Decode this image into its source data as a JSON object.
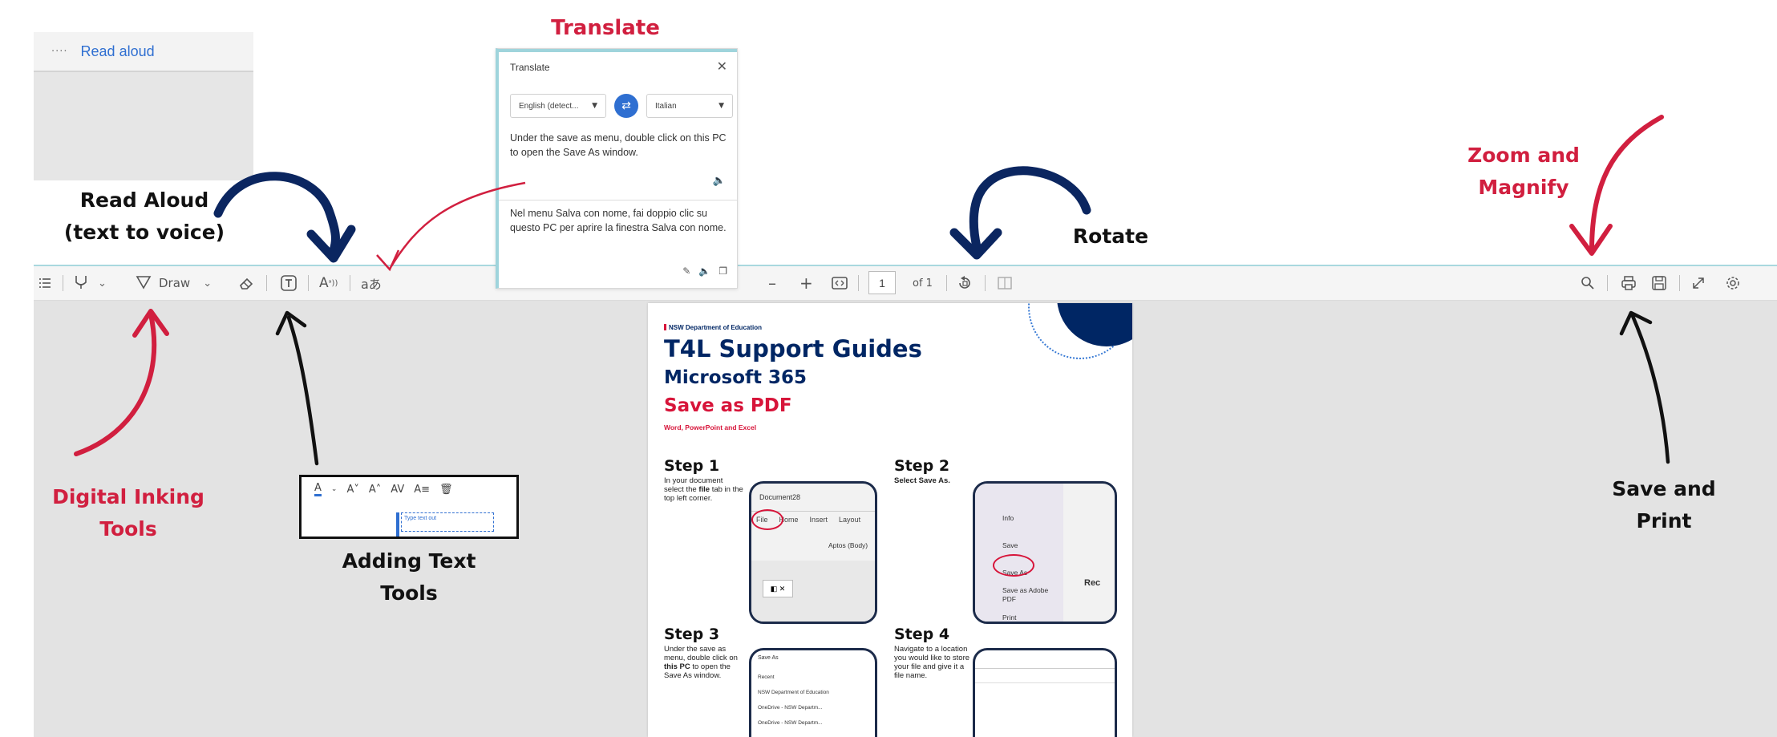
{
  "annotations": {
    "translate": "Translate",
    "read_aloud": [
      "Read Aloud",
      "(text to voice)"
    ],
    "rotate": "Rotate",
    "zoom": [
      "Zoom and",
      "Magnify"
    ],
    "inking": [
      "Digital Inking",
      "Tools"
    ],
    "adding_text": [
      "Adding Text",
      "Tools"
    ],
    "save_print": [
      "Save and",
      "Print"
    ]
  },
  "read_aloud_bar": {
    "dots": "····",
    "label": "Read aloud"
  },
  "toolbar": {
    "draw_label": "Draw",
    "page_number": "1",
    "page_of": "of 1",
    "icons": [
      "contents-icon",
      "highlight-icon",
      "draw-icon",
      "eraser-icon",
      "add-text-icon",
      "read-aloud-icon",
      "translate-icon",
      "zoom-out-icon",
      "zoom-in-icon",
      "fit-width-icon",
      "rotate-icon",
      "two-page-icon",
      "search-icon",
      "print-icon",
      "save-icon",
      "fullscreen-icon",
      "settings-icon"
    ]
  },
  "translate_panel": {
    "title": "Translate",
    "from_lang": "English (detect...",
    "to_lang": "Italian",
    "source_text": "Under the save as menu, double click on this PC to open the Save As window.",
    "translated_text": "Nel menu Salva con nome, fai doppio clic su questo PC per aprire la finestra Salva con nome."
  },
  "text_format_popup": {
    "placeholder": "Type text out"
  },
  "document": {
    "department": "NSW Department of Education",
    "title": "T4L Support Guides",
    "subtitle": "Microsoft 365",
    "heading": "Save as PDF",
    "apps": "Word, PowerPoint and Excel",
    "steps": [
      {
        "title": "Step 1",
        "text": [
          "In your document",
          "select the",
          "file",
          "tab",
          "in the top left",
          "corner."
        ]
      },
      {
        "title": "Step 2",
        "text": "Select Save As."
      },
      {
        "title": "Step 3",
        "text": [
          "Under the save as",
          "menu, double click",
          "on",
          "this PC",
          "to open",
          "the Save As",
          "window."
        ]
      },
      {
        "title": "Step 4",
        "text": [
          "Navigate to a",
          "location you",
          "would like to",
          "store your file",
          "and give it a",
          "file name."
        ]
      }
    ],
    "shot1": {
      "doc_name": "Document28",
      "tabs": [
        "File",
        "Home",
        "Insert",
        "Layout"
      ],
      "font": "Aptos (Body)"
    },
    "shot2": {
      "items": [
        "Info",
        "Save",
        "Save As",
        "Save as Adobe PDF",
        "Print"
      ],
      "side": "Rec"
    },
    "shot3": {
      "title": "Save As",
      "items": [
        "Recent",
        "NSW Department of Education",
        "OneDrive - NSW Departm...",
        "OneDrive - NSW Departm..."
      ]
    }
  }
}
